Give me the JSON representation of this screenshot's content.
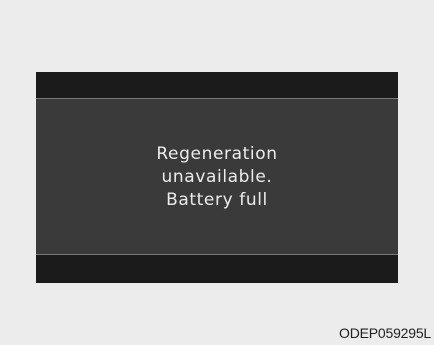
{
  "display": {
    "message_lines": [
      "Regeneration",
      "unavailable.",
      "Battery full"
    ]
  },
  "figure": {
    "code": "ODEP059295L"
  },
  "colors": {
    "page_background": "#ececec",
    "display_bezel": "#1b1b1b",
    "display_panel": "#3a3a3a",
    "divider_line": "#7a7a7a",
    "message_text": "#ececec",
    "caption_text": "#222222"
  }
}
